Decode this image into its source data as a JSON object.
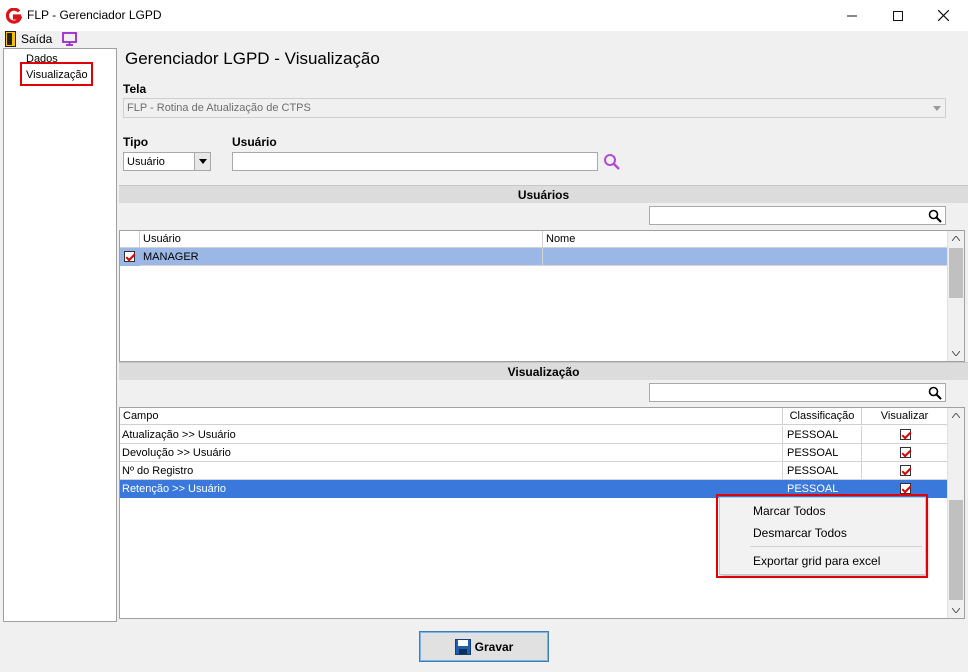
{
  "window": {
    "title": "FLP - Gerenciador LGPD"
  },
  "toolbar": {
    "exit_label": "Saída"
  },
  "tree": {
    "items": [
      "Dados",
      "Visualização"
    ]
  },
  "page": {
    "title": "Gerenciador LGPD - Visualização"
  },
  "form": {
    "tela_label": "Tela",
    "tela_value": "FLP - Rotina de Atualização de CTPS",
    "tipo_label": "Tipo",
    "tipo_value": "Usuário",
    "usuario_label": "Usuário",
    "usuario_value": ""
  },
  "users_section": {
    "title": "Usuários",
    "columns": [
      "Usuário",
      "Nome"
    ],
    "rows": [
      {
        "usuario": "MANAGER",
        "nome": "",
        "checked": true
      }
    ]
  },
  "view_section": {
    "title": "Visualização",
    "columns": [
      "Campo",
      "Classificação",
      "Visualizar"
    ],
    "rows": [
      {
        "campo": "Atualização >> Usuário",
        "classificacao": "PESSOAL",
        "visualizar": true
      },
      {
        "campo": "Devolução >> Usuário",
        "classificacao": "PESSOAL",
        "visualizar": true
      },
      {
        "campo": "Nº do Registro",
        "classificacao": "PESSOAL",
        "visualizar": true
      },
      {
        "campo": "Retenção >> Usuário",
        "classificacao": "PESSOAL",
        "visualizar": true
      }
    ]
  },
  "context_menu": {
    "items": [
      "Marcar Todos",
      "Desmarcar Todos",
      "Exportar grid para excel"
    ]
  },
  "footer": {
    "save_label": "Gravar"
  },
  "colors": {
    "selection_light": "#9ab7e6",
    "selection_dark": "#3a78dc",
    "highlight_red": "#e0000a"
  }
}
